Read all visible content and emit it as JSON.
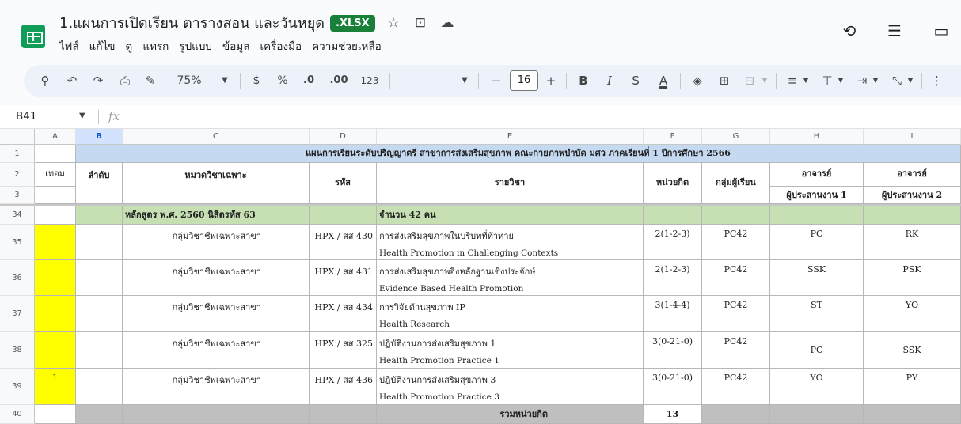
{
  "header": {
    "title": "1.แผนการเปิดเรียน ตารางสอน และวันหยุด",
    "badge": ".XLSX",
    "menu": [
      "ไฟล์",
      "แก้ไข",
      "ดู",
      "แทรก",
      "รูปแบบ",
      "ข้อมูล",
      "เครื่องมือ",
      "ความช่วยเหลือ"
    ]
  },
  "toolbar": {
    "zoom": "75%",
    "currency": "$",
    "percent": "%",
    "decrease_decimal": ".0",
    "increase_decimal": ".00",
    "format_123": "123",
    "font_size": "16",
    "bold": "B",
    "italic": "I",
    "strike": "S",
    "text_color": "A"
  },
  "formula_bar": {
    "name_box": "B41",
    "fx": "fx"
  },
  "grid": {
    "columns": [
      "A",
      "B",
      "C",
      "D",
      "E",
      "F",
      "G",
      "H",
      "I"
    ],
    "row_numbers": [
      "1",
      "2",
      "3",
      "34",
      "35",
      "36",
      "37",
      "38",
      "39",
      "40"
    ],
    "banner": "แผนการเรียนระดับปริญญาตรี สาขาการส่งเสริมสุขภาพ คณะกายภาพบำบัด มศว ภาคเรียนที่ 1 ปีการศึกษา 2566",
    "headers": {
      "term": "เทอม",
      "order": "ลำดับ",
      "category": "หมวดวิชาเฉพาะ",
      "code": "รหัส",
      "course": "รายวิชา",
      "credits": "หน่วยกิต",
      "group": "กลุ่มผู้เรียน",
      "teacher1_top": "อาจารย์",
      "teacher1_bottom": "ผู้ประสานงาน 1",
      "teacher2_top": "อาจารย์",
      "teacher2_bottom": "ผู้ประสานงาน 2"
    },
    "curriculum_row": {
      "curriculum": "หลักสูตร พ.ศ. 2560 นิสิตรหัส 63",
      "count": "จำนวน 42 คน"
    },
    "rows": [
      {
        "term": "",
        "category": "กลุ่มวิชาชีพเฉพาะสาขา",
        "code": "HPX / สส 430",
        "course_th": "การส่งเสริมสุขภาพในบริบทที่ท้าทาย",
        "course_en": "Health Promotion in Challenging Contexts",
        "credits": "2(1-2-3)",
        "group": "PC42",
        "t1": "PC",
        "t2": "RK"
      },
      {
        "term": "",
        "category": "กลุ่มวิชาชีพเฉพาะสาขา",
        "code": "HPX / สส 431",
        "course_th": "การส่งเสริมสุขภาพอิงหลักฐานเชิงประจักษ์",
        "course_en": "Evidence Based Health Promotion",
        "credits": "2(1-2-3)",
        "group": "PC42",
        "t1": "SSK",
        "t2": "PSK"
      },
      {
        "term": "",
        "category": "กลุ่มวิชาชีพเฉพาะสาขา",
        "code": "HPX / สส 434",
        "course_th": "การวิจัยด้านสุขภาพ IP",
        "course_en": "Health Research",
        "credits": "3(1-4-4)",
        "group": "PC42",
        "t1": "ST",
        "t2": "YO"
      },
      {
        "term": "",
        "category": "กลุ่มวิชาชีพเฉพาะสาขา",
        "code": "HPX / สส 325",
        "course_th": "ปฏิบัติงานการส่งเสริมสุขภาพ 1",
        "course_en": "Health Promotion Practice 1",
        "credits": "3(0-21-0)",
        "group": "PC42",
        "t1": "PC",
        "t2": "SSK"
      },
      {
        "term": "1",
        "category": "กลุ่มวิชาชีพเฉพาะสาขา",
        "code": "HPX / สส 436",
        "course_th": "ปฏิบัติงานการส่งเสริมสุขภาพ 3",
        "course_en": "Health Promotion Practice 3",
        "credits": "3(0-21-0)",
        "group": "PC42",
        "t1": "YO",
        "t2": "PY"
      }
    ],
    "total": {
      "label": "รวมหน่วยกิต",
      "credits": "13"
    }
  },
  "colors": {
    "banner": "#c5d9f1",
    "curriculum": "#c6e0b4",
    "term_highlight": "#ffff00",
    "total_row": "#bfbfbf",
    "brand": "#0f9d58"
  }
}
